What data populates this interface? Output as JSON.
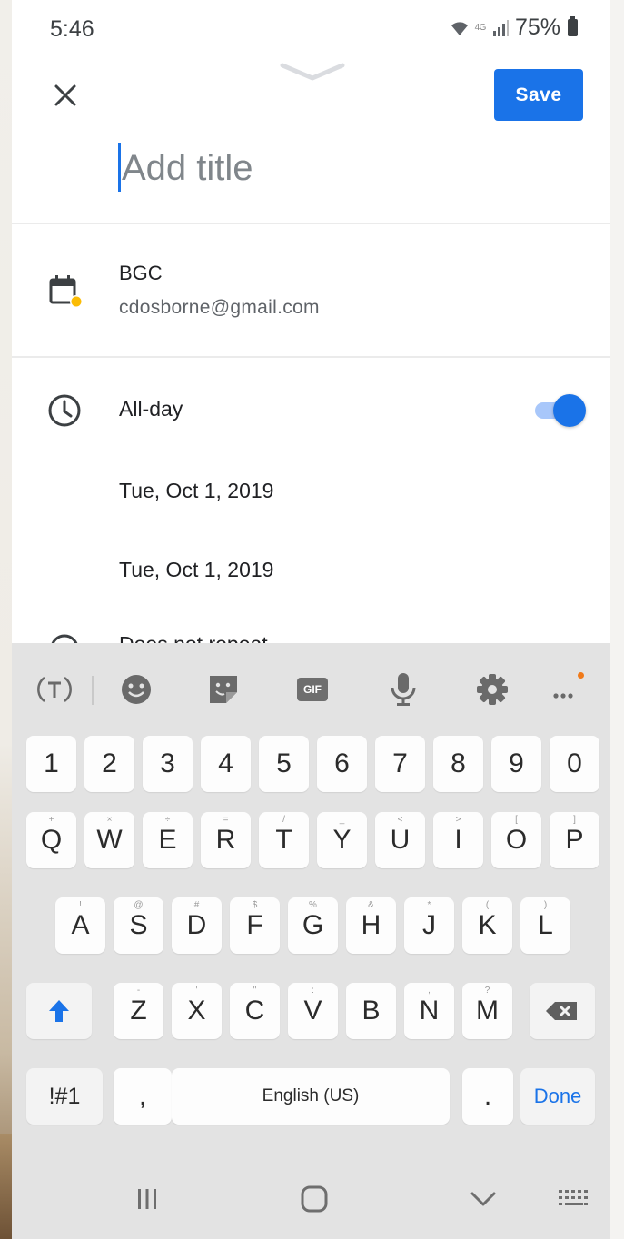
{
  "status_bar": {
    "time": "5:46",
    "network": "4G",
    "battery": "75%"
  },
  "header": {
    "save_label": "Save",
    "title_placeholder": "Add title"
  },
  "calendar": {
    "name": "BGC",
    "account": "cdosborne@gmail.com",
    "icon": "calendar-icon",
    "dot_color": "#fbbc04"
  },
  "all_day": {
    "label": "All-day",
    "enabled": true
  },
  "dates": {
    "start": "Tue, Oct 1, 2019",
    "end": "Tue, Oct 1, 2019"
  },
  "repeat": {
    "label": "Does not repeat"
  },
  "keyboard": {
    "toolbar": [
      "text-mode-icon",
      "emoji-icon",
      "sticker-icon",
      "gif-icon",
      "mic-icon",
      "settings-icon",
      "more-icon"
    ],
    "gif_label": "GIF",
    "rows": {
      "numbers": [
        "1",
        "2",
        "3",
        "4",
        "5",
        "6",
        "7",
        "8",
        "9",
        "0"
      ],
      "row1": [
        "Q",
        "W",
        "E",
        "R",
        "T",
        "Y",
        "U",
        "I",
        "O",
        "P"
      ],
      "row1_alt": [
        "+",
        "×",
        "÷",
        "=",
        "/",
        "_",
        "<",
        ">",
        "[",
        "]"
      ],
      "row2": [
        "A",
        "S",
        "D",
        "F",
        "G",
        "H",
        "J",
        "K",
        "L"
      ],
      "row2_alt": [
        "!",
        "@",
        "#",
        "$",
        "%",
        "&",
        "*",
        "(",
        ")"
      ],
      "row3": [
        "Z",
        "X",
        "C",
        "V",
        "B",
        "N",
        "M"
      ],
      "row3_alt": [
        "-",
        "'",
        "\"",
        ":",
        ";",
        ",",
        "?"
      ]
    },
    "symbols_label": "!#1",
    "comma_label": ",",
    "space_label": "English (US)",
    "period_label": ".",
    "done_label": "Done"
  },
  "colors": {
    "accent": "#1a73e8",
    "keyboard_bg": "#e3e3e3"
  }
}
